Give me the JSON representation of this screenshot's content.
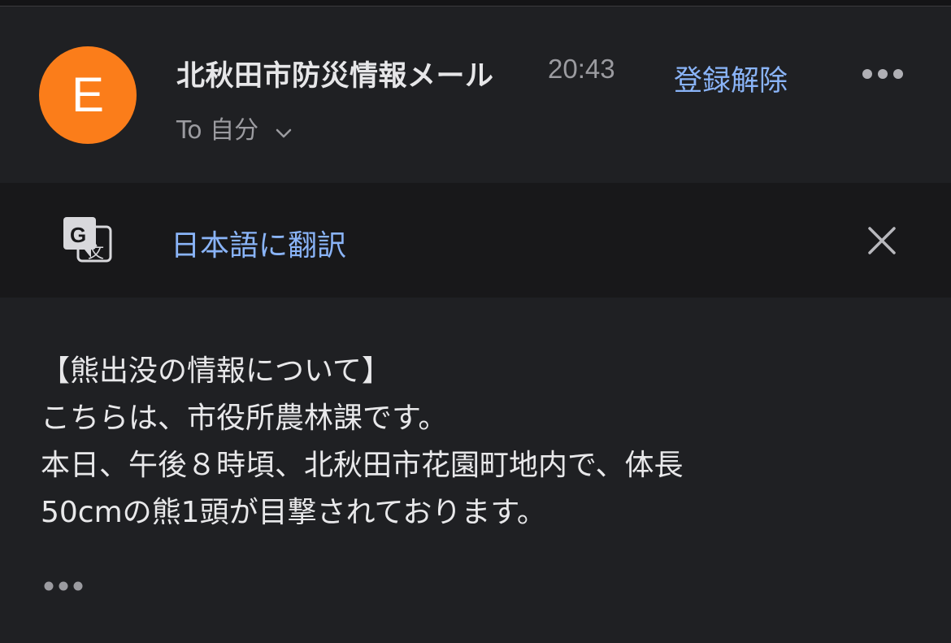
{
  "email": {
    "avatar_letter": "E",
    "avatar_color": "#fb7d1a",
    "sender": "北秋田市防災情報メール",
    "time": "20:43",
    "unsubscribe_label": "登録解除",
    "recipient": "To 自分",
    "header_more_icon": "more-horizontal-icon",
    "recipient_expand_icon": "chevron-down-icon"
  },
  "translate": {
    "icon": "google-translate-icon",
    "label": "日本語に翻訳",
    "close_icon": "close-icon"
  },
  "body": {
    "lines": [
      "【熊出没の情報について】",
      "こちらは、市役所農林課です。",
      "本日、午後８時頃、北秋田市花園町地内で、体長",
      "50cmの熊1頭が目撃されております。"
    ],
    "more_icon": "more-horizontal-icon"
  },
  "colors": {
    "background": "#1f2023",
    "translate_bar": "#18181a",
    "link": "#8ab4f8",
    "text": "#e8e8ea",
    "muted": "#9b9ba0"
  }
}
